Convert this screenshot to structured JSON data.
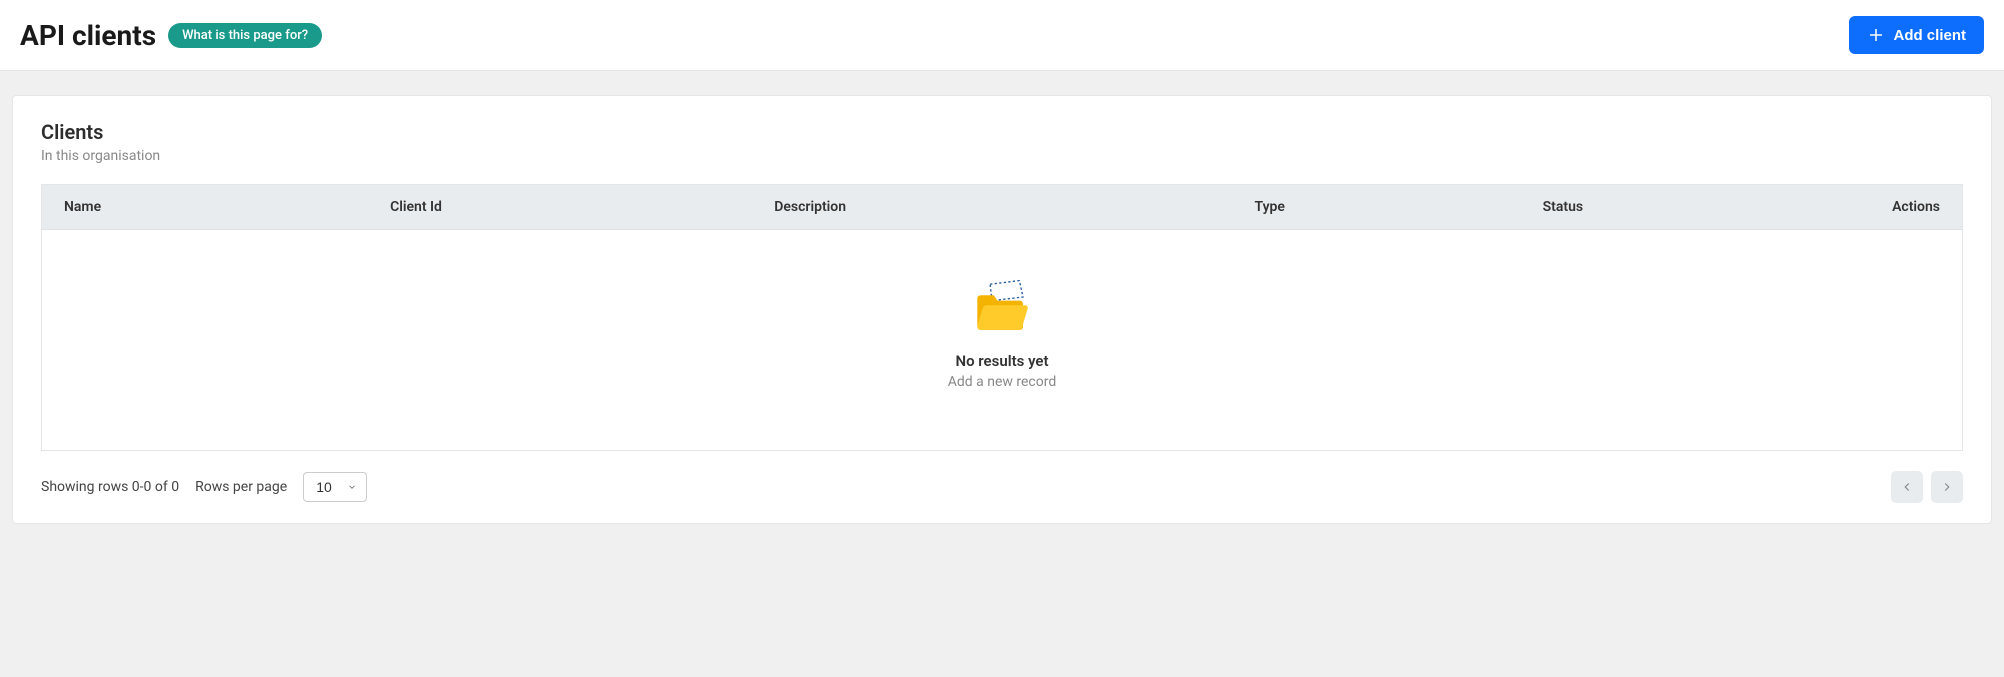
{
  "header": {
    "title": "API clients",
    "info_pill": "What is this page for?",
    "add_button": "Add client"
  },
  "card": {
    "title": "Clients",
    "subtitle": "In this organisation"
  },
  "table": {
    "columns": {
      "name": "Name",
      "client_id": "Client Id",
      "description": "Description",
      "type": "Type",
      "status": "Status",
      "actions": "Actions"
    },
    "empty": {
      "title": "No results yet",
      "subtitle": "Add a new record"
    }
  },
  "footer": {
    "showing": "Showing rows 0-0 of 0",
    "rows_per_page_label": "Rows per page",
    "rows_per_page_value": "10"
  }
}
